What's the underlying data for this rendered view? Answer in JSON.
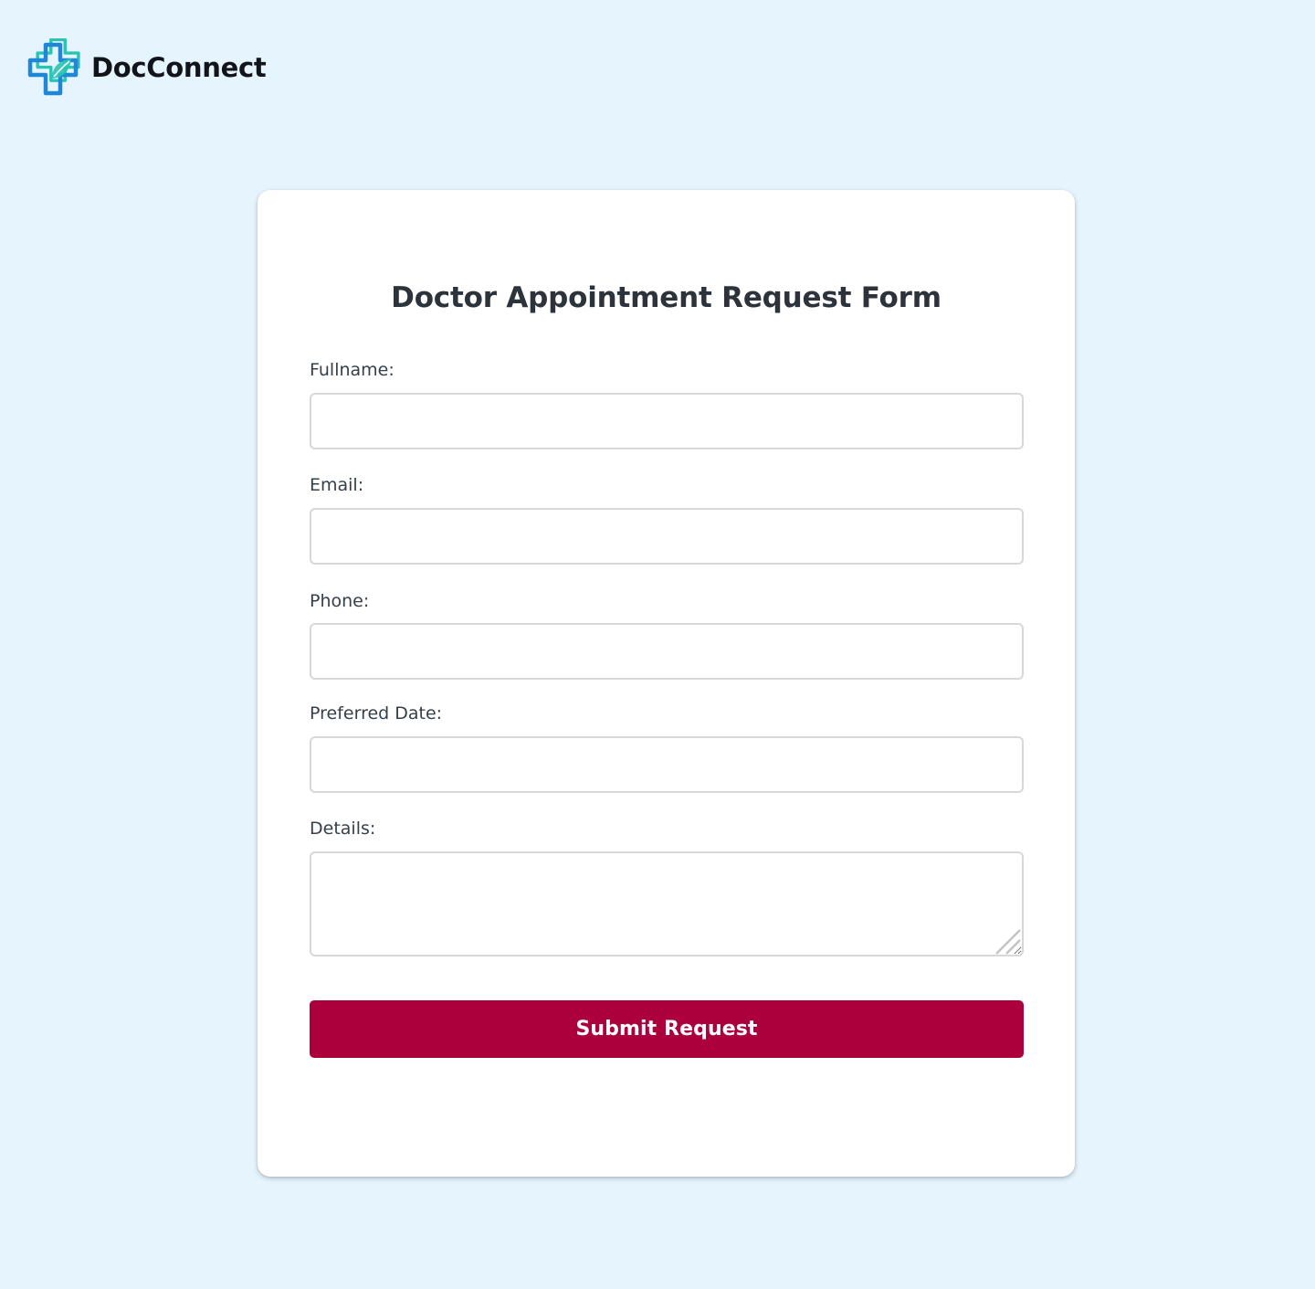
{
  "brand": {
    "name": "DocConnect",
    "logo_icon": "medical-cross-logo",
    "colors": {
      "primary": "#1f87d6",
      "secondary": "#2bc3b4"
    }
  },
  "form": {
    "title": "Doctor Appointment Request Form",
    "fields": [
      {
        "label": "Fullname:",
        "type": "text",
        "value": "",
        "placeholder": ""
      },
      {
        "label": "Email:",
        "type": "email",
        "value": "",
        "placeholder": ""
      },
      {
        "label": "Phone:",
        "type": "tel",
        "value": "",
        "placeholder": ""
      },
      {
        "label": "Preferred Date:",
        "type": "text",
        "value": "",
        "placeholder": ""
      },
      {
        "label": "Details:",
        "type": "textarea",
        "value": "",
        "placeholder": ""
      }
    ],
    "submit_label": "Submit Request"
  },
  "colors": {
    "page_background": "#e6f4fd",
    "card_background": "#ffffff",
    "button_background": "#ab003c",
    "button_text": "#ffffff",
    "title_text": "#2c333b",
    "label_text": "#34414a",
    "input_border": "#d8d8d8"
  }
}
